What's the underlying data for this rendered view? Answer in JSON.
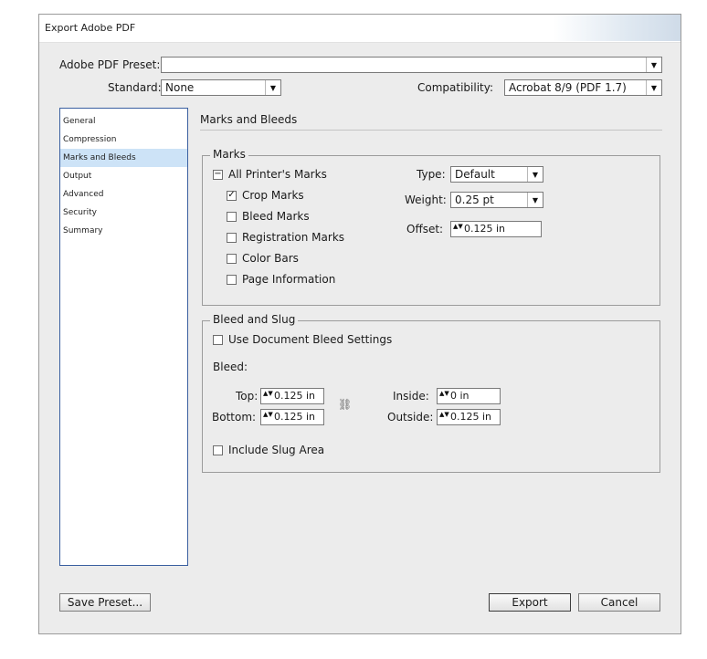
{
  "dialog": {
    "title": "Export Adobe PDF",
    "preset_label": "Adobe PDF Preset:",
    "preset_value": "",
    "standard_label": "Standard:",
    "standard_value": "None",
    "compatibility_label": "Compatibility:",
    "compatibility_value": "Acrobat 8/9 (PDF 1.7)"
  },
  "sidebar": {
    "items": [
      {
        "label": "General"
      },
      {
        "label": "Compression"
      },
      {
        "label": "Marks and Bleeds"
      },
      {
        "label": "Output"
      },
      {
        "label": "Advanced"
      },
      {
        "label": "Security"
      },
      {
        "label": "Summary"
      }
    ],
    "active": "Marks and Bleeds"
  },
  "main": {
    "title": "Marks and Bleeds",
    "marks": {
      "legend": "Marks",
      "all_printers_marks": {
        "label": "All Printer's Marks",
        "state": "mixed"
      },
      "options": [
        {
          "label": "Crop Marks",
          "checked": true
        },
        {
          "label": "Bleed Marks",
          "checked": false
        },
        {
          "label": "Registration Marks",
          "checked": false
        },
        {
          "label": "Color Bars",
          "checked": false
        },
        {
          "label": "Page Information",
          "checked": false
        }
      ],
      "type_label": "Type:",
      "type_value": "Default",
      "weight_label": "Weight:",
      "weight_value": "0.25 pt",
      "offset_label": "Offset:",
      "offset_value": "0.125 in"
    },
    "bleed": {
      "legend": "Bleed and Slug",
      "use_document_label": "Use Document Bleed Settings",
      "use_document_checked": false,
      "bleed_heading": "Bleed:",
      "top_label": "Top:",
      "top_value": "0.125 in",
      "bottom_label": "Bottom:",
      "bottom_value": "0.125 in",
      "inside_label": "Inside:",
      "inside_value": "0 in",
      "outside_label": "Outside:",
      "outside_value": "0.125 in",
      "include_slug_label": "Include Slug Area",
      "include_slug_checked": false
    }
  },
  "footer": {
    "save_preset": "Save Preset...",
    "export": "Export",
    "cancel": "Cancel"
  },
  "glyphs": {
    "arrow": "▼",
    "check": "✓",
    "mixed": "−",
    "spin": "▲▼",
    "chain": "⛓"
  },
  "colors": {
    "dialog_bg": "#ececec",
    "selected_nav": "#cde3f7",
    "nav_border": "#3a5fa0"
  }
}
